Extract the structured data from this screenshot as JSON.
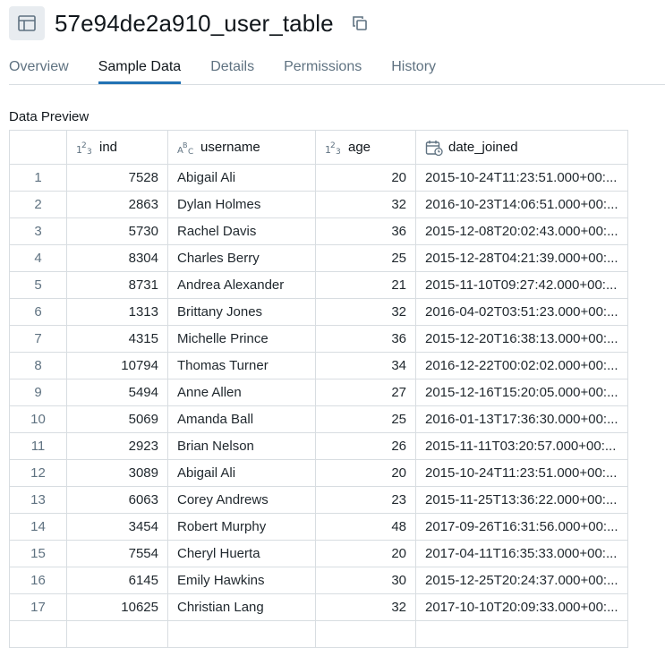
{
  "header": {
    "title": "57e94de2a910_user_table"
  },
  "tabs": [
    {
      "label": "Overview"
    },
    {
      "label": "Sample Data"
    },
    {
      "label": "Details"
    },
    {
      "label": "Permissions"
    },
    {
      "label": "History"
    }
  ],
  "section_label": "Data Preview",
  "columns": [
    {
      "name": "ind",
      "type_icon": "integer-type-icon"
    },
    {
      "name": "username",
      "type_icon": "string-type-icon"
    },
    {
      "name": "age",
      "type_icon": "integer-type-icon"
    },
    {
      "name": "date_joined",
      "type_icon": "calendar-type-icon"
    }
  ],
  "rows": [
    {
      "n": "1",
      "ind": "7528",
      "username": "Abigail Ali",
      "age": "20",
      "date_joined": "2015-10-24T11:23:51.000+00:..."
    },
    {
      "n": "2",
      "ind": "2863",
      "username": "Dylan Holmes",
      "age": "32",
      "date_joined": "2016-10-23T14:06:51.000+00:..."
    },
    {
      "n": "3",
      "ind": "5730",
      "username": "Rachel Davis",
      "age": "36",
      "date_joined": "2015-12-08T20:02:43.000+00:..."
    },
    {
      "n": "4",
      "ind": "8304",
      "username": "Charles Berry",
      "age": "25",
      "date_joined": "2015-12-28T04:21:39.000+00:..."
    },
    {
      "n": "5",
      "ind": "8731",
      "username": "Andrea Alexander",
      "age": "21",
      "date_joined": "2015-11-10T09:27:42.000+00:..."
    },
    {
      "n": "6",
      "ind": "1313",
      "username": "Brittany Jones",
      "age": "32",
      "date_joined": "2016-04-02T03:51:23.000+00:..."
    },
    {
      "n": "7",
      "ind": "4315",
      "username": "Michelle Prince",
      "age": "36",
      "date_joined": "2015-12-20T16:38:13.000+00:..."
    },
    {
      "n": "8",
      "ind": "10794",
      "username": "Thomas Turner",
      "age": "34",
      "date_joined": "2016-12-22T00:02:02.000+00:..."
    },
    {
      "n": "9",
      "ind": "5494",
      "username": "Anne Allen",
      "age": "27",
      "date_joined": "2015-12-16T15:20:05.000+00:..."
    },
    {
      "n": "10",
      "ind": "5069",
      "username": "Amanda Ball",
      "age": "25",
      "date_joined": "2016-01-13T17:36:30.000+00:..."
    },
    {
      "n": "11",
      "ind": "2923",
      "username": "Brian Nelson",
      "age": "26",
      "date_joined": "2015-11-11T03:20:57.000+00:..."
    },
    {
      "n": "12",
      "ind": "3089",
      "username": "Abigail Ali",
      "age": "20",
      "date_joined": "2015-10-24T11:23:51.000+00:..."
    },
    {
      "n": "13",
      "ind": "6063",
      "username": "Corey Andrews",
      "age": "23",
      "date_joined": "2015-11-25T13:36:22.000+00:..."
    },
    {
      "n": "14",
      "ind": "3454",
      "username": "Robert Murphy",
      "age": "48",
      "date_joined": "2017-09-26T16:31:56.000+00:..."
    },
    {
      "n": "15",
      "ind": "7554",
      "username": "Cheryl Huerta",
      "age": "20",
      "date_joined": "2017-04-11T16:35:33.000+00:..."
    },
    {
      "n": "16",
      "ind": "6145",
      "username": "Emily Hawkins",
      "age": "30",
      "date_joined": "2015-12-25T20:24:37.000+00:..."
    },
    {
      "n": "17",
      "ind": "10625",
      "username": "Christian Lang",
      "age": "32",
      "date_joined": "2017-10-10T20:09:33.000+00:..."
    },
    {
      "n": "",
      "ind": "",
      "username": "",
      "age": "",
      "date_joined": ""
    }
  ],
  "colors": {
    "accent": "#2272b4",
    "muted_text": "#5f7281",
    "border": "#d8dde1"
  }
}
